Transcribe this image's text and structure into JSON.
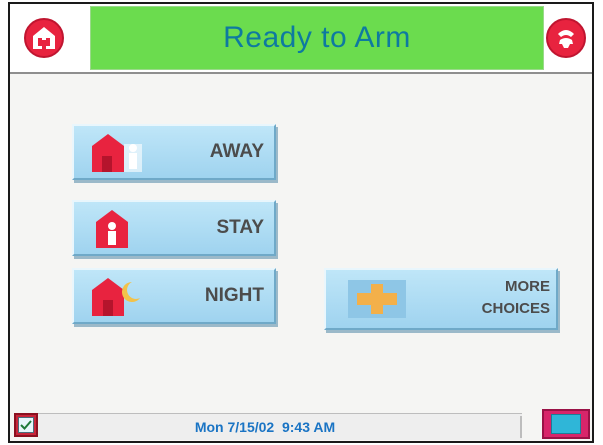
{
  "header": {
    "title": "Ready to Arm",
    "left_icon": "house-icon",
    "right_icon": "phone-handset-icon"
  },
  "buttons": {
    "away": {
      "label": "AWAY",
      "icon": "house-person-away-icon"
    },
    "stay": {
      "label": "STAY",
      "icon": "house-person-stay-icon"
    },
    "night": {
      "label": "NIGHT",
      "icon": "house-moon-night-icon"
    },
    "more": {
      "label_line1": "MORE",
      "label_line2": "CHOICES",
      "icon": "plus-icon"
    }
  },
  "footer": {
    "datetime": "Mon 7/15/02  9:43 AM",
    "left_icon": "checkbox-icon",
    "right_icon": "book-icon"
  },
  "colors": {
    "title_bar": "#6bdc4e",
    "title_text": "#0e7aa0",
    "button_face": "#bfe6f8",
    "icon_red": "#e8233f",
    "datetime_text": "#1a74c4"
  }
}
